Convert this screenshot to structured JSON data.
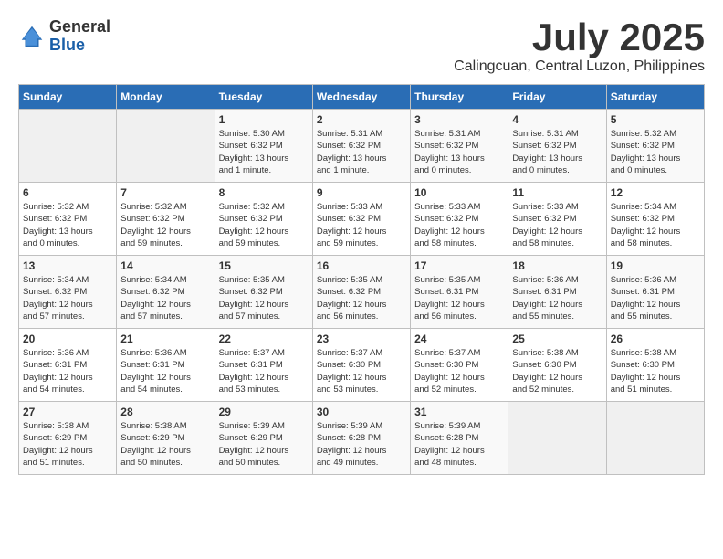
{
  "header": {
    "logo_general": "General",
    "logo_blue": "Blue",
    "month_title": "July 2025",
    "location": "Calingcuan, Central Luzon, Philippines"
  },
  "weekdays": [
    "Sunday",
    "Monday",
    "Tuesday",
    "Wednesday",
    "Thursday",
    "Friday",
    "Saturday"
  ],
  "weeks": [
    [
      {
        "day": "",
        "info": ""
      },
      {
        "day": "",
        "info": ""
      },
      {
        "day": "1",
        "info": "Sunrise: 5:30 AM\nSunset: 6:32 PM\nDaylight: 13 hours\nand 1 minute."
      },
      {
        "day": "2",
        "info": "Sunrise: 5:31 AM\nSunset: 6:32 PM\nDaylight: 13 hours\nand 1 minute."
      },
      {
        "day": "3",
        "info": "Sunrise: 5:31 AM\nSunset: 6:32 PM\nDaylight: 13 hours\nand 0 minutes."
      },
      {
        "day": "4",
        "info": "Sunrise: 5:31 AM\nSunset: 6:32 PM\nDaylight: 13 hours\nand 0 minutes."
      },
      {
        "day": "5",
        "info": "Sunrise: 5:32 AM\nSunset: 6:32 PM\nDaylight: 13 hours\nand 0 minutes."
      }
    ],
    [
      {
        "day": "6",
        "info": "Sunrise: 5:32 AM\nSunset: 6:32 PM\nDaylight: 13 hours\nand 0 minutes."
      },
      {
        "day": "7",
        "info": "Sunrise: 5:32 AM\nSunset: 6:32 PM\nDaylight: 12 hours\nand 59 minutes."
      },
      {
        "day": "8",
        "info": "Sunrise: 5:32 AM\nSunset: 6:32 PM\nDaylight: 12 hours\nand 59 minutes."
      },
      {
        "day": "9",
        "info": "Sunrise: 5:33 AM\nSunset: 6:32 PM\nDaylight: 12 hours\nand 59 minutes."
      },
      {
        "day": "10",
        "info": "Sunrise: 5:33 AM\nSunset: 6:32 PM\nDaylight: 12 hours\nand 58 minutes."
      },
      {
        "day": "11",
        "info": "Sunrise: 5:33 AM\nSunset: 6:32 PM\nDaylight: 12 hours\nand 58 minutes."
      },
      {
        "day": "12",
        "info": "Sunrise: 5:34 AM\nSunset: 6:32 PM\nDaylight: 12 hours\nand 58 minutes."
      }
    ],
    [
      {
        "day": "13",
        "info": "Sunrise: 5:34 AM\nSunset: 6:32 PM\nDaylight: 12 hours\nand 57 minutes."
      },
      {
        "day": "14",
        "info": "Sunrise: 5:34 AM\nSunset: 6:32 PM\nDaylight: 12 hours\nand 57 minutes."
      },
      {
        "day": "15",
        "info": "Sunrise: 5:35 AM\nSunset: 6:32 PM\nDaylight: 12 hours\nand 57 minutes."
      },
      {
        "day": "16",
        "info": "Sunrise: 5:35 AM\nSunset: 6:32 PM\nDaylight: 12 hours\nand 56 minutes."
      },
      {
        "day": "17",
        "info": "Sunrise: 5:35 AM\nSunset: 6:31 PM\nDaylight: 12 hours\nand 56 minutes."
      },
      {
        "day": "18",
        "info": "Sunrise: 5:36 AM\nSunset: 6:31 PM\nDaylight: 12 hours\nand 55 minutes."
      },
      {
        "day": "19",
        "info": "Sunrise: 5:36 AM\nSunset: 6:31 PM\nDaylight: 12 hours\nand 55 minutes."
      }
    ],
    [
      {
        "day": "20",
        "info": "Sunrise: 5:36 AM\nSunset: 6:31 PM\nDaylight: 12 hours\nand 54 minutes."
      },
      {
        "day": "21",
        "info": "Sunrise: 5:36 AM\nSunset: 6:31 PM\nDaylight: 12 hours\nand 54 minutes."
      },
      {
        "day": "22",
        "info": "Sunrise: 5:37 AM\nSunset: 6:31 PM\nDaylight: 12 hours\nand 53 minutes."
      },
      {
        "day": "23",
        "info": "Sunrise: 5:37 AM\nSunset: 6:30 PM\nDaylight: 12 hours\nand 53 minutes."
      },
      {
        "day": "24",
        "info": "Sunrise: 5:37 AM\nSunset: 6:30 PM\nDaylight: 12 hours\nand 52 minutes."
      },
      {
        "day": "25",
        "info": "Sunrise: 5:38 AM\nSunset: 6:30 PM\nDaylight: 12 hours\nand 52 minutes."
      },
      {
        "day": "26",
        "info": "Sunrise: 5:38 AM\nSunset: 6:30 PM\nDaylight: 12 hours\nand 51 minutes."
      }
    ],
    [
      {
        "day": "27",
        "info": "Sunrise: 5:38 AM\nSunset: 6:29 PM\nDaylight: 12 hours\nand 51 minutes."
      },
      {
        "day": "28",
        "info": "Sunrise: 5:38 AM\nSunset: 6:29 PM\nDaylight: 12 hours\nand 50 minutes."
      },
      {
        "day": "29",
        "info": "Sunrise: 5:39 AM\nSunset: 6:29 PM\nDaylight: 12 hours\nand 50 minutes."
      },
      {
        "day": "30",
        "info": "Sunrise: 5:39 AM\nSunset: 6:28 PM\nDaylight: 12 hours\nand 49 minutes."
      },
      {
        "day": "31",
        "info": "Sunrise: 5:39 AM\nSunset: 6:28 PM\nDaylight: 12 hours\nand 48 minutes."
      },
      {
        "day": "",
        "info": ""
      },
      {
        "day": "",
        "info": ""
      }
    ]
  ]
}
